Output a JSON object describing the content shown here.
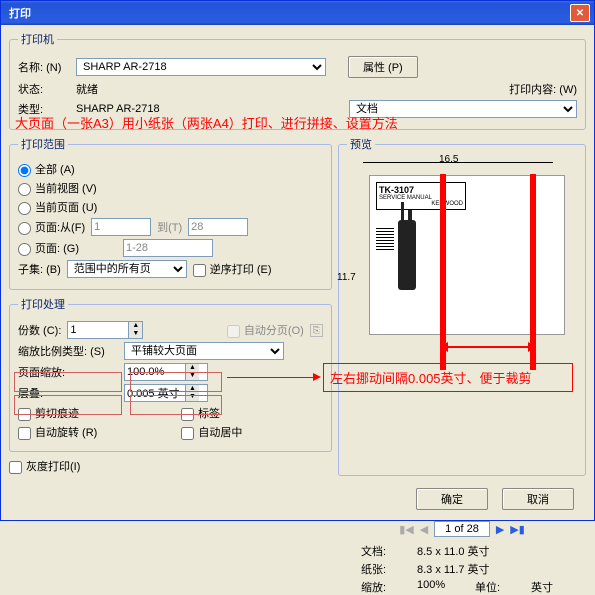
{
  "title": "打印",
  "printer": {
    "legend": "打印机",
    "name_lbl": "名称: (N)",
    "name_val": "SHARP AR-2718",
    "props_btn": "属性 (P)",
    "status_lbl": "状态:",
    "status_val": "就绪",
    "content_lbl": "打印内容: (W)",
    "type_lbl": "类型:",
    "type_val": "SHARP AR-2718",
    "content_val": "文档"
  },
  "annot_top": "大页面（一张A3）用小纸张（两张A4）打印、进行拼接、设置方法",
  "range": {
    "legend": "打印范围",
    "all": "全部 (A)",
    "curview": "当前视图 (V)",
    "curpage": "当前页面 (U)",
    "pagesfrom": "页面:从(F)",
    "from_val": "1",
    "to_lbl": "到(T)",
    "to_val": "28",
    "pages": "页面: (G)",
    "pages_val": "1-28",
    "subset_lbl": "子集: (B)",
    "subset_val": "范围中的所有页",
    "reverse": "逆序打印 (E)"
  },
  "handling": {
    "legend": "打印处理",
    "copies_lbl": "份数 (C):",
    "copies_val": "1",
    "collate": "自动分页(O)",
    "scaletype_lbl": "缩放比例类型: (S)",
    "scaletype_val": "平铺较大页面",
    "pagescale_lbl": "页面缩放:",
    "pagescale_val": "100.0%",
    "overlap_lbl": "层叠:",
    "overlap_val": "0.005 英寸",
    "cutmarks": "剪切痕迹",
    "labels": "标签",
    "autorotate": "自动旋转 (R)",
    "autocenter": "自动居中"
  },
  "gray": "灰度打印(I)",
  "preview": {
    "legend": "预览",
    "width": "16.5",
    "height": "11.7",
    "device": "TK-3107",
    "brand": "KENWOOD",
    "manual": "SERVICE MANUAL"
  },
  "nav": {
    "page": "1 of 28"
  },
  "info": {
    "doc_lbl": "文档:",
    "doc_val": "8.5 x 11.0 英寸",
    "paper_lbl": "纸张:",
    "paper_val": "8.3 x 11.7 英寸",
    "scale_lbl": "缩放:",
    "scale_val": "100%",
    "unit_lbl": "单位:",
    "unit_val": "英寸"
  },
  "annot_side": "左右挪动间隔0.005英寸、便于裁剪",
  "ok": "确定",
  "cancel": "取消"
}
